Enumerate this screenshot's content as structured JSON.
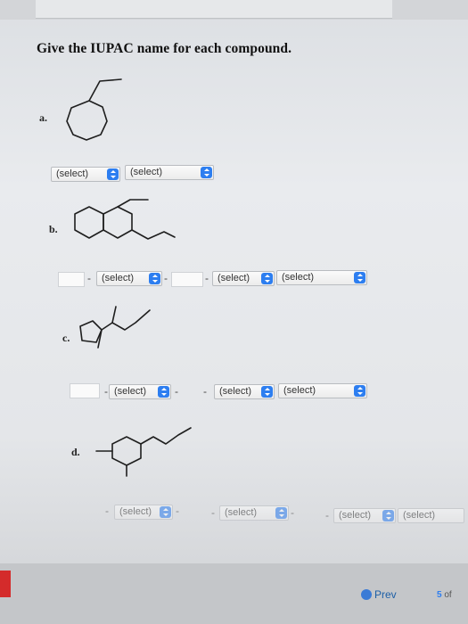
{
  "header": {
    "title": "Give the IUPAC name for each compound."
  },
  "labels": {
    "a": "a.",
    "b": "b.",
    "c": "c.",
    "d": "d."
  },
  "select_text": "(select)",
  "part_a": {
    "selects": [
      "(select)",
      "(select)"
    ]
  },
  "part_b": {
    "selects": [
      "(select)",
      "(select)",
      "(select)"
    ]
  },
  "part_c": {
    "selects": [
      "(select)",
      "(select)",
      "(select)"
    ]
  },
  "part_d": {
    "selects": [
      "(select)",
      "(select)",
      "(select)",
      "(select)"
    ]
  },
  "dash": "-",
  "footer": {
    "prev_label": "Prev",
    "page": "5",
    "of": "of"
  },
  "icons": {
    "select_arrow": "updown-chevron-icon",
    "prev": "prev-arrow-icon"
  },
  "colors": {
    "select_accent": "#2d7ef0",
    "link": "#1d5fa6"
  }
}
